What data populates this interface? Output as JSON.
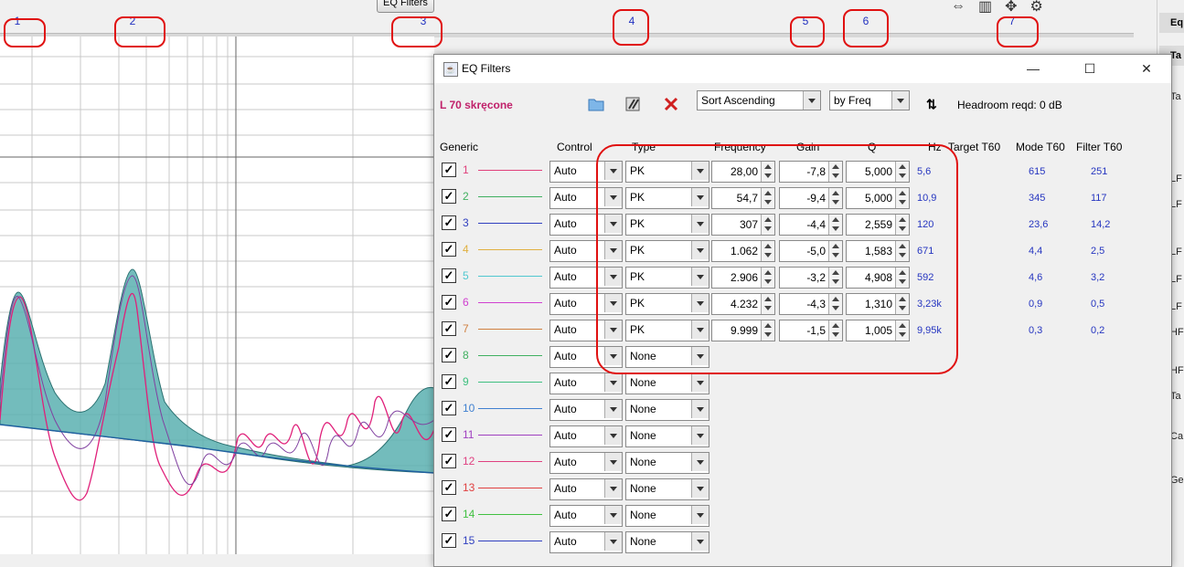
{
  "toolbar": {
    "eq_filters_button": "EQ Filters"
  },
  "markers": [
    "1",
    "2",
    "3",
    "4",
    "5",
    "6",
    "7"
  ],
  "right_panel": {
    "header": "Eq",
    "tab": "Ta",
    "items": [
      "Ta",
      "LF",
      "LF",
      "LF",
      "LF",
      "LF",
      "HF",
      "HF",
      "Ta",
      "Ca",
      "Ge"
    ]
  },
  "dialog": {
    "title": "EQ Filters",
    "measurement_name": "L 70 skręcone",
    "sort_select": "Sort Ascending",
    "by_select": "by Freq",
    "headroom": "Headroom reqd:  0 dB",
    "columns": {
      "generic": "Generic",
      "control": "Control",
      "type": "Type",
      "frequency": "Frequency",
      "gain": "Gain",
      "q": "Q",
      "hz": "Hz",
      "target_t60": "Target T60",
      "mode_t60": "Mode T60",
      "filter_t60": "Filter T60"
    },
    "filters": [
      {
        "num": "1",
        "color": "#e0407a",
        "control": "Auto",
        "type": "PK",
        "freq": "28,00",
        "gain": "-7,8",
        "q": "5,000",
        "hz": "5,6",
        "mode": "615",
        "filter": "251"
      },
      {
        "num": "2",
        "color": "#40b060",
        "control": "Auto",
        "type": "PK",
        "freq": "54,7",
        "gain": "-9,4",
        "q": "5,000",
        "hz": "10,9",
        "mode": "345",
        "filter": "117"
      },
      {
        "num": "3",
        "color": "#3040c0",
        "control": "Auto",
        "type": "PK",
        "freq": "307",
        "gain": "-4,4",
        "q": "2,559",
        "hz": "120",
        "mode": "23,6",
        "filter": "14,2"
      },
      {
        "num": "4",
        "color": "#e0b040",
        "control": "Auto",
        "type": "PK",
        "freq": "1.062",
        "gain": "-5,0",
        "q": "1,583",
        "hz": "671",
        "mode": "4,4",
        "filter": "2,5"
      },
      {
        "num": "5",
        "color": "#50c8d0",
        "control": "Auto",
        "type": "PK",
        "freq": "2.906",
        "gain": "-3,2",
        "q": "4,908",
        "hz": "592",
        "mode": "4,6",
        "filter": "3,2"
      },
      {
        "num": "6",
        "color": "#d040d0",
        "control": "Auto",
        "type": "PK",
        "freq": "4.232",
        "gain": "-4,3",
        "q": "1,310",
        "hz": "3,23k",
        "mode": "0,9",
        "filter": "0,5"
      },
      {
        "num": "7",
        "color": "#d08040",
        "control": "Auto",
        "type": "PK",
        "freq": "9.999",
        "gain": "-1,5",
        "q": "1,005",
        "hz": "9,95k",
        "mode": "0,3",
        "filter": "0,2"
      },
      {
        "num": "8",
        "color": "#40b060",
        "control": "Auto",
        "type": "None"
      },
      {
        "num": "9",
        "color": "#40c080",
        "control": "Auto",
        "type": "None"
      },
      {
        "num": "10",
        "color": "#4080d0",
        "control": "Auto",
        "type": "None"
      },
      {
        "num": "11",
        "color": "#a040c0",
        "control": "Auto",
        "type": "None"
      },
      {
        "num": "12",
        "color": "#e04080",
        "control": "Auto",
        "type": "None"
      },
      {
        "num": "13",
        "color": "#e04040",
        "control": "Auto",
        "type": "None"
      },
      {
        "num": "14",
        "color": "#40c040",
        "control": "Auto",
        "type": "None"
      },
      {
        "num": "15",
        "color": "#3040c0",
        "control": "Auto",
        "type": "None"
      }
    ]
  }
}
